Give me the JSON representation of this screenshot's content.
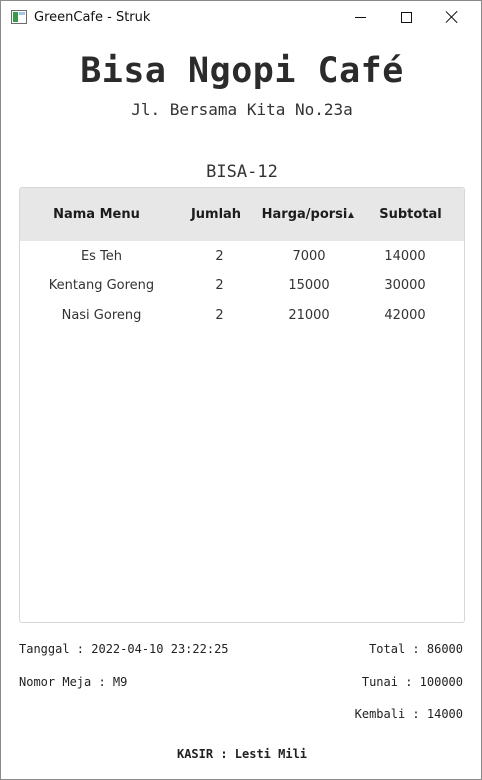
{
  "window": {
    "title": "GreenCafe - Struk",
    "controls": [
      "minimize-icon",
      "maximize-icon",
      "close-icon"
    ]
  },
  "receipt": {
    "cafe_name": "Bisa Ngopi Café",
    "address": "Jl. Bersama Kita No.23a",
    "order_code": "BISA-12"
  },
  "table": {
    "headers": {
      "name": "Nama Menu",
      "qty": "Jumlah",
      "price": "Harga/porsi",
      "subtotal": "Subtotal"
    },
    "sort_indicator": "sort-ascending-icon",
    "rows": [
      {
        "name": "Es Teh",
        "qty": "2",
        "price": "7000",
        "subtotal": "14000"
      },
      {
        "name": "Kentang Goreng",
        "qty": "2",
        "price": "15000",
        "subtotal": "30000"
      },
      {
        "name": "Nasi Goreng",
        "qty": "2",
        "price": "21000",
        "subtotal": "42000"
      }
    ]
  },
  "footer": {
    "tanggal": "Tanggal : 2022-04-10 23:22:25",
    "nomor_meja": "Nomor Meja : M9",
    "total": "Total : 86000",
    "tunai": "Tunai : 100000",
    "kembali": "Kembali : 14000",
    "kasir": "KASIR : Lesti Mili"
  }
}
